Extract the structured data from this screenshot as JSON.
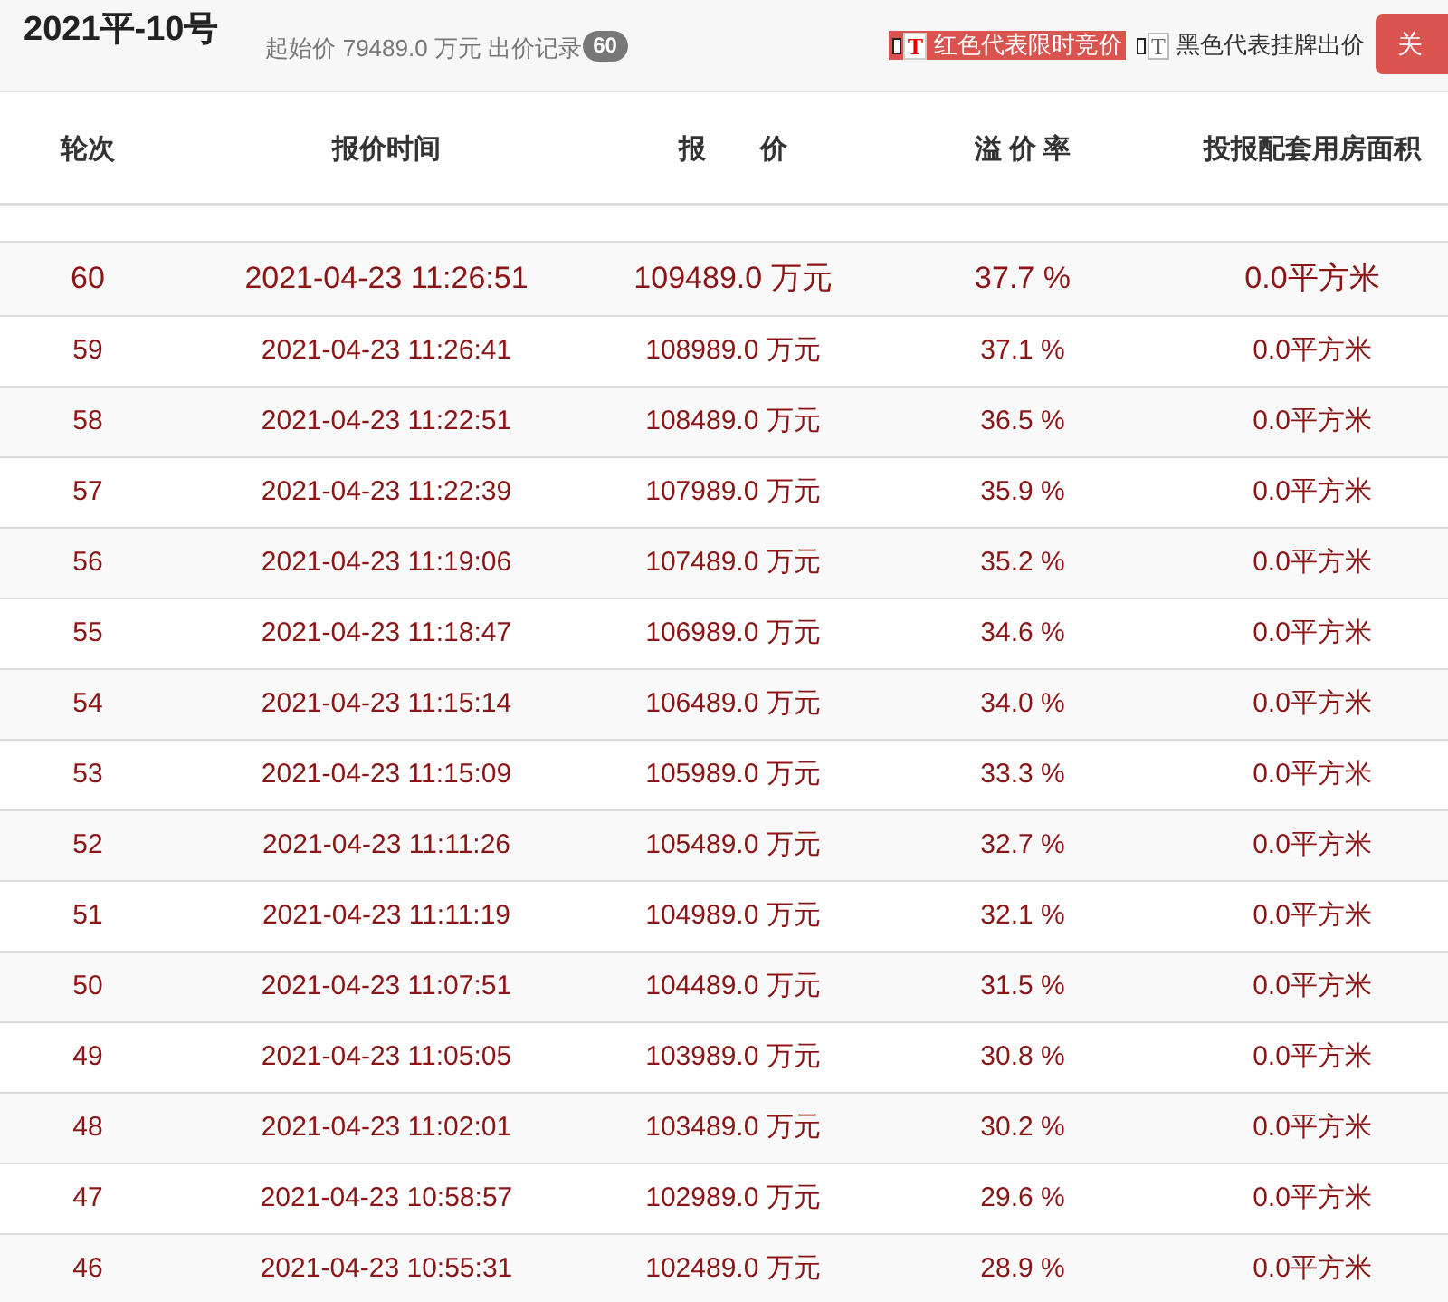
{
  "header": {
    "title": "2021平-10号",
    "start_price_label": "起始价 79489.0 万元 出价记录",
    "bid_count": "60",
    "legend": [
      {
        "kind": "red",
        "glyph": "T",
        "label": "红色代表限时竞价"
      },
      {
        "kind": "black",
        "glyph": "T",
        "label": "黑色代表挂牌出价"
      }
    ],
    "close_button": "关"
  },
  "table": {
    "columns": [
      "轮次",
      "报价时间",
      "报　　价",
      "溢 价 率",
      "投报配套用房面积"
    ],
    "rows": [
      {
        "kind": "red",
        "latest": true,
        "cells": [
          "60",
          "2021-04-23 11:26:51",
          "109489.0 万元",
          "37.7 %",
          "0.0平方米"
        ]
      },
      {
        "kind": "red",
        "latest": false,
        "cells": [
          "59",
          "2021-04-23 11:26:41",
          "108989.0 万元",
          "37.1 %",
          "0.0平方米"
        ]
      },
      {
        "kind": "red",
        "latest": false,
        "cells": [
          "58",
          "2021-04-23 11:22:51",
          "108489.0 万元",
          "36.5 %",
          "0.0平方米"
        ]
      },
      {
        "kind": "red",
        "latest": false,
        "cells": [
          "57",
          "2021-04-23 11:22:39",
          "107989.0 万元",
          "35.9 %",
          "0.0平方米"
        ]
      },
      {
        "kind": "red",
        "latest": false,
        "cells": [
          "56",
          "2021-04-23 11:19:06",
          "107489.0 万元",
          "35.2 %",
          "0.0平方米"
        ]
      },
      {
        "kind": "red",
        "latest": false,
        "cells": [
          "55",
          "2021-04-23 11:18:47",
          "106989.0 万元",
          "34.6 %",
          "0.0平方米"
        ]
      },
      {
        "kind": "red",
        "latest": false,
        "cells": [
          "54",
          "2021-04-23 11:15:14",
          "106489.0 万元",
          "34.0 %",
          "0.0平方米"
        ]
      },
      {
        "kind": "red",
        "latest": false,
        "cells": [
          "53",
          "2021-04-23 11:15:09",
          "105989.0 万元",
          "33.3 %",
          "0.0平方米"
        ]
      },
      {
        "kind": "red",
        "latest": false,
        "cells": [
          "52",
          "2021-04-23 11:11:26",
          "105489.0 万元",
          "32.7 %",
          "0.0平方米"
        ]
      },
      {
        "kind": "red",
        "latest": false,
        "cells": [
          "51",
          "2021-04-23 11:11:19",
          "104989.0 万元",
          "32.1 %",
          "0.0平方米"
        ]
      },
      {
        "kind": "red",
        "latest": false,
        "cells": [
          "50",
          "2021-04-23 11:07:51",
          "104489.0 万元",
          "31.5 %",
          "0.0平方米"
        ]
      },
      {
        "kind": "red",
        "latest": false,
        "cells": [
          "49",
          "2021-04-23 11:05:05",
          "103989.0 万元",
          "30.8 %",
          "0.0平方米"
        ]
      },
      {
        "kind": "red",
        "latest": false,
        "cells": [
          "48",
          "2021-04-23 11:02:01",
          "103489.0 万元",
          "30.2 %",
          "0.0平方米"
        ]
      },
      {
        "kind": "red",
        "latest": false,
        "cells": [
          "47",
          "2021-04-23 10:58:57",
          "102989.0 万元",
          "29.6 %",
          "0.0平方米"
        ]
      },
      {
        "kind": "red",
        "latest": false,
        "cells": [
          "46",
          "2021-04-23 10:55:31",
          "102489.0 万元",
          "28.9 %",
          "0.0平方米"
        ]
      }
    ]
  }
}
